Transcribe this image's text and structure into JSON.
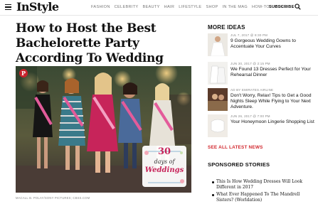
{
  "header": {
    "logo": "InStyle",
    "nav": [
      "FASHION",
      "CELEBRITY",
      "BEAUTY",
      "HAIR",
      "LIFESTYLE",
      "SHOP",
      "IN THE MAG",
      "HOW-TO",
      "VIDEO"
    ],
    "subscribe": "SUBSCRIBE",
    "menu_icon": "hamburger-menu-icon",
    "search_icon": "search-icon"
  },
  "article": {
    "headline": "How to Host the Best Bachelorette Party According To Wedding Pros",
    "image_credit": "MACALL B. POLAY/SONY PICTURES; CBSS.COM",
    "pin_icon": "pinterest-icon",
    "image_overlay": {
      "number": "30",
      "line1": "days of",
      "line2": "Weddings"
    }
  },
  "sidebar": {
    "title": "MORE IDEAS",
    "items": [
      {
        "meta": "JUL 7, 2017 @ 8:30 PM",
        "text": "9 Gorgeous Wedding Gowns to Accentuate Your Curves"
      },
      {
        "meta": "JUN 30, 2017 @ 2:15 PM",
        "text": "We Found 13 Dresses Perfect for Your Rehearsal Dinner"
      },
      {
        "meta": "AD BY EMIRATES AIRLINE",
        "text": "Don't Worry, Relax! Tips to Get a Good Nights Sleep While Flying to Your Next Adventure."
      },
      {
        "meta": "JUN 26, 2017 @ 7:00 PM",
        "text": "Your Honeymoon Lingerie Shopping List"
      }
    ],
    "see_all": "SEE ALL LATEST NEWS",
    "sponsored_title": "SPONSORED STORIES",
    "sponsored": [
      "This Is How Wedding Dresses Will Look Different in 2017",
      "What Ever Happened To The Mandrell Sisters? (Worldation)"
    ]
  },
  "colors": {
    "accent": "#d2292f",
    "text": "#111111",
    "muted": "#888888"
  }
}
